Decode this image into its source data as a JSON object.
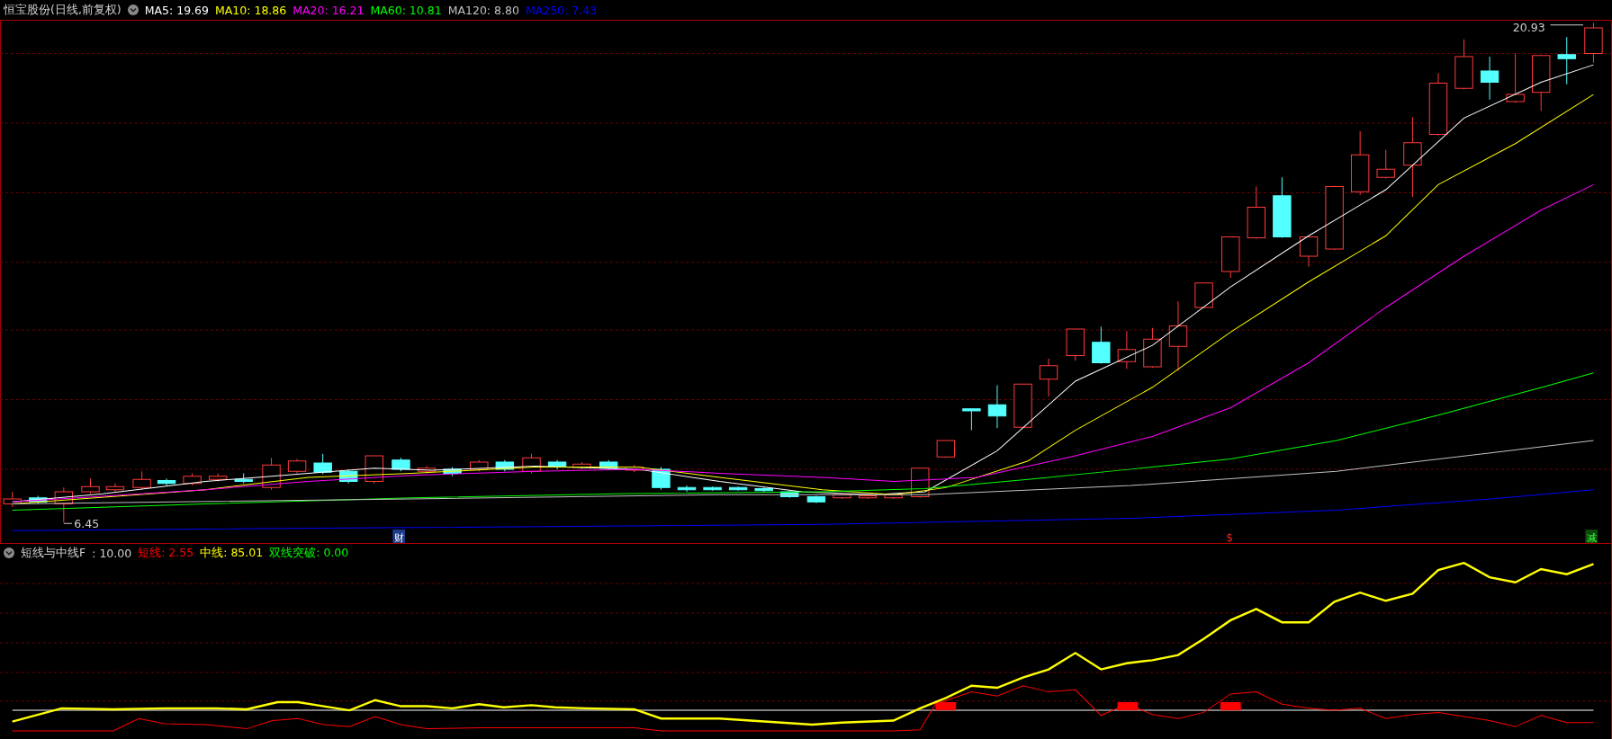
{
  "main_panel": {
    "title": "恒宝股份(日线,前复权)",
    "indicators": [
      {
        "label": "MA5: 19.69",
        "color": "#ffffff"
      },
      {
        "label": "MA10: 18.86",
        "color": "#ffff00"
      },
      {
        "label": "MA20: 16.21",
        "color": "#ff00ff"
      },
      {
        "label": "MA60: 10.81",
        "color": "#00ff00"
      },
      {
        "label": "MA120: 8.80",
        "color": "#c0c0c0"
      },
      {
        "label": "MA250: 7.43",
        "color": "#0000ff"
      }
    ],
    "price_labels": [
      {
        "kind": "high",
        "text": "20.93"
      },
      {
        "kind": "low",
        "text": "6.45"
      }
    ],
    "event_marks": [
      {
        "kind": "finance",
        "text": "财"
      },
      {
        "kind": "dividend",
        "text": "$"
      },
      {
        "kind": "reduce",
        "text": "减"
      }
    ]
  },
  "sub_panel": {
    "title": "短线与中线F",
    "value": ": 10.00",
    "indicators": [
      {
        "label": "短线: 2.55",
        "color": "#ff0000"
      },
      {
        "label": "中线: 85.01",
        "color": "#ffff00"
      },
      {
        "label": "双线突破: 0.00",
        "color": "#00ff00"
      }
    ]
  }
}
